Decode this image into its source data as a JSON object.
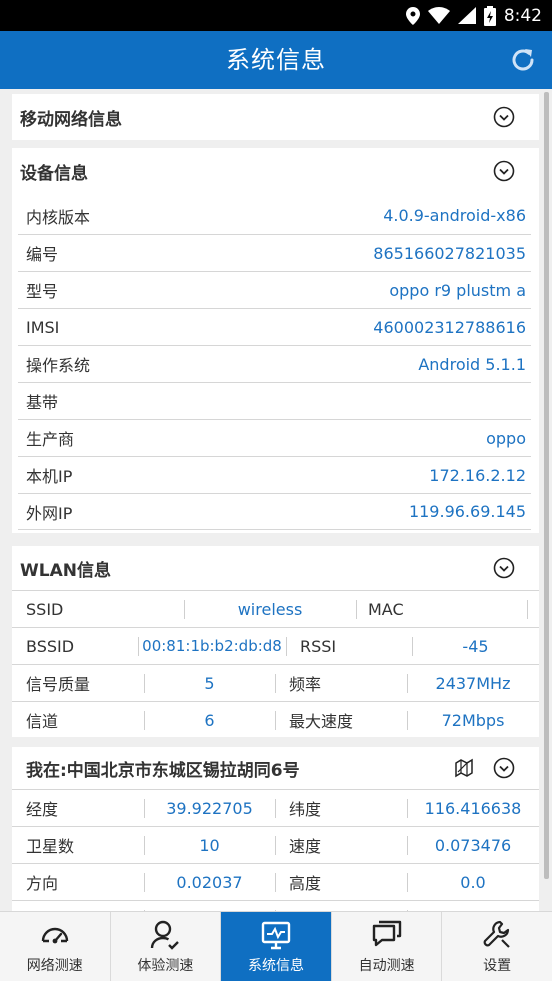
{
  "status_bar": {
    "time": "8:42"
  },
  "app_bar": {
    "title": "系统信息"
  },
  "sections": {
    "mobile_network": {
      "title": "移动网络信息"
    },
    "device": {
      "title": "设备信息",
      "rows": [
        {
          "label": "内核版本",
          "value": "4.0.9-android-x86"
        },
        {
          "label": "编号",
          "value": "865166027821035"
        },
        {
          "label": "型号",
          "value": "oppo r9 plustm a"
        },
        {
          "label": "IMSI",
          "value": "460002312788616"
        },
        {
          "label": "操作系统",
          "value": "Android 5.1.1"
        },
        {
          "label": "基带",
          "value": ""
        },
        {
          "label": "生产商",
          "value": "oppo"
        },
        {
          "label": "本机IP",
          "value": "172.16.2.12"
        },
        {
          "label": "外网IP",
          "value": "119.96.69.145"
        }
      ]
    },
    "wlan": {
      "title": "WLAN信息",
      "ssid_label": "SSID",
      "ssid_value": "wireless",
      "mac_label": "MAC",
      "mac_value": "",
      "bssid_label": "BSSID",
      "bssid_value": "00:81:1b:b2:db:d8",
      "rssi_label": "RSSI",
      "rssi_value": "-45",
      "quality_label": "信号质量",
      "quality_value": "5",
      "freq_label": "频率",
      "freq_value": "2437MHz",
      "channel_label": "信道",
      "channel_value": "6",
      "maxspeed_label": "最大速度",
      "maxspeed_value": "72Mbps"
    },
    "location": {
      "title": "我在:中国北京市东城区锡拉胡同6号",
      "lon_label": "经度",
      "lon_value": "39.922705",
      "lat_label": "纬度",
      "lat_value": "116.416638",
      "sat_label": "卫星数",
      "sat_value": "10",
      "speed_label": "速度",
      "speed_value": "0.073476",
      "dir_label": "方向",
      "dir_value": "0.02037",
      "alt_label": "高度",
      "alt_value": "0.0"
    }
  },
  "bottom_nav": [
    {
      "label": "网络测速",
      "icon": "speedometer-icon"
    },
    {
      "label": "体验测速",
      "icon": "user-check-icon"
    },
    {
      "label": "系统信息",
      "icon": "monitor-icon",
      "active": true
    },
    {
      "label": "自动测速",
      "icon": "chat-bubbles-icon"
    },
    {
      "label": "设置",
      "icon": "wrench-icon"
    }
  ],
  "colors": {
    "primary": "#0f6fc2",
    "value_text": "#1e73c2",
    "background": "#efefef"
  }
}
